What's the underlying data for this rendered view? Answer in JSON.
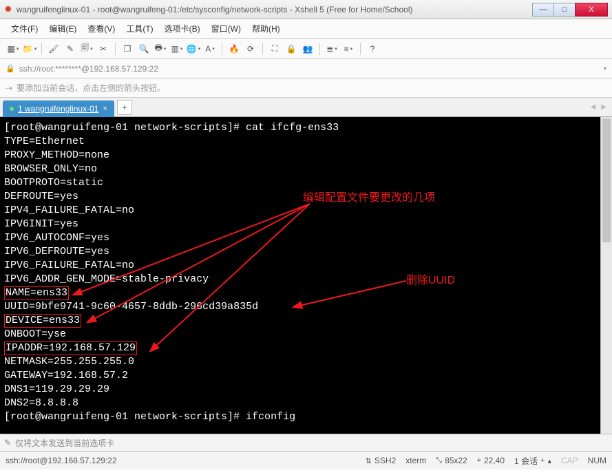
{
  "window": {
    "title": "wangruifenglinux-01 - root@wangruifeng-01:/etc/sysconfig/network-scripts - Xshell 5 (Free for Home/School)",
    "min": "—",
    "max": "□",
    "close": "X"
  },
  "menu": {
    "file": "文件(F)",
    "edit": "编辑(E)",
    "view": "查看(V)",
    "tools": "工具(T)",
    "tabs": "选项卡(B)",
    "window": "窗口(W)",
    "help": "帮助(H)"
  },
  "toolbar_icons": {
    "new": "▦",
    "folder": "📁",
    "brush": "🖌",
    "pencil": "✎",
    "clip": "🗐",
    "scissors": "✂",
    "copy": "❐",
    "search": "🔍",
    "print": "🖶",
    "cols": "▥",
    "globe": "🌐",
    "font": "A",
    "flame2": "🔥",
    "refresh": "⟳",
    "expand": "⛶",
    "lock": "🔒",
    "users": "👥",
    "list": "≣",
    "lines": "≡",
    "help": "?"
  },
  "address": {
    "lock": "🔒",
    "text": "ssh://root:********@192.168.57.129:22",
    "dd": "▾"
  },
  "hint": {
    "icon": "⇢",
    "text": "要添加当前会话，点击左侧的箭头按钮。"
  },
  "tab": {
    "label": "1 wangruifenglinux-01",
    "add": "+",
    "prev": "◀",
    "next": "▶"
  },
  "terminal": {
    "prompt1": "[root@wangruifeng-01 network-scripts]# cat ifcfg-ens33",
    "l1": "TYPE=Ethernet",
    "l2": "PROXY_METHOD=none",
    "l3": "BROWSER_ONLY=no",
    "l4": "BOOTPROTO=static",
    "l5": "DEFROUTE=yes",
    "l6": "IPV4_FAILURE_FATAL=no",
    "l7": "IPV6INIT=yes",
    "l8": "IPV6_AUTOCONF=yes",
    "l9": "IPV6_DEFROUTE=yes",
    "l10a": "IPV6_FAILURE_FATAL=n",
    "l10b": "o",
    "l11a": "IPV6_ADDR_GEN_M",
    "l11b": "OD",
    "l11c": "E=stable-p",
    "l11d": "r",
    "l11e": "ivacy",
    "l12": "NAME=ens33",
    "l13a": "UUID=9bfe9741-9c6",
    "l13b": "0",
    "l13c": "-4657-8ddb-2",
    "l13d": "96",
    "l13e": "cd39a835d",
    "l14": "DEVICE=ens33",
    "l15": "ONBOOT=yse",
    "l16": "IPADDR=192.168.57.129",
    "l17": "NETMASK=255.255.255.0",
    "l18": "GATEWAY=192.168.57.2",
    "l19": "DNS1=119.29.29.29",
    "l20": "DNS2=8.8.8.8",
    "prompt2": "[root@wangruifeng-01 network-scripts]# ifconfig",
    "anno1": "编辑配置文件要更改的几项",
    "anno2": "删除UUID"
  },
  "inputbar": {
    "pen": "✎",
    "placeholder": "仅将文本发送到当前选项卡"
  },
  "status": {
    "left": "ssh://root@192.168.57.129:22",
    "ssh": "SSH2",
    "term": "xterm",
    "size": "85x22",
    "pos": "22,40",
    "session": "1 会话",
    "cap": "CAP",
    "num": "NUM",
    "ico_ssh": "⇅",
    "ico_size": "⤡",
    "ico_pos": "⌖",
    "ico_sess": "+",
    "ico_arrow": "▴"
  }
}
